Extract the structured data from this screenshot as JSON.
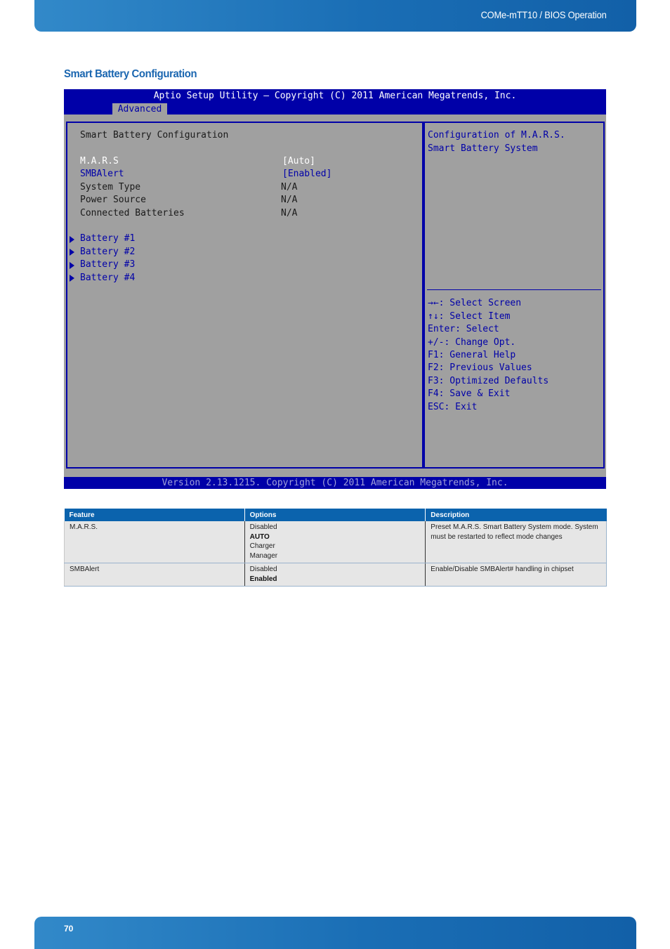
{
  "header": {
    "doc_title": "COMe-mTT10 / BIOS Operation"
  },
  "section_title": "Smart Battery Configuration",
  "bios": {
    "title": "Aptio Setup Utility – Copyright (C) 2011 American Megatrends, Inc.",
    "active_tab": "Advanced",
    "page_heading": "Smart Battery Configuration",
    "settings": [
      {
        "label": "M.A.R.S",
        "value": "[Auto]",
        "state": "selected"
      },
      {
        "label": "SMBAlert",
        "value": "[Enabled]",
        "state": "selectable"
      },
      {
        "label": "System Type",
        "value": "N/A",
        "state": "readonly"
      },
      {
        "label": "Power Source",
        "value": "N/A",
        "state": "readonly"
      },
      {
        "label": "Connected Batteries",
        "value": "N/A",
        "state": "readonly"
      }
    ],
    "submenus": [
      "Battery #1",
      "Battery #2",
      "Battery #3",
      "Battery #4"
    ],
    "help_text": [
      "Configuration of M.A.R.S.",
      "Smart Battery System"
    ],
    "key_help": [
      "→←: Select Screen",
      "↑↓: Select Item",
      "Enter: Select",
      "+/-: Change Opt.",
      "F1: General Help",
      "F2: Previous Values",
      "F3: Optimized Defaults",
      "F4: Save & Exit",
      "ESC: Exit"
    ],
    "footer": "Version 2.13.1215. Copyright (C) 2011 American Megatrends, Inc.",
    "colors": {
      "bios_blue": "#0000a8",
      "bios_gray": "#a0a0a0"
    }
  },
  "table": {
    "headers": [
      "Feature",
      "Options",
      "Description"
    ],
    "rows": [
      {
        "feature": "M.A.R.S.",
        "options": [
          {
            "label": "Disabled",
            "default": false
          },
          {
            "label": "AUTO",
            "default": true
          },
          {
            "label": "Charger",
            "default": false
          },
          {
            "label": "Manager",
            "default": false
          }
        ],
        "description": "Preset M.A.R.S. Smart Battery System mode. System must be restarted to reflect mode changes"
      },
      {
        "feature": "SMBAlert",
        "options": [
          {
            "label": "Disabled",
            "default": false
          },
          {
            "label": "Enabled",
            "default": true
          }
        ],
        "description": "Enable/Disable SMBAlert# handling in chipset"
      }
    ]
  },
  "footer": {
    "page_number": "70"
  },
  "colors": {
    "brand_blue": "#1a6eb5",
    "heading_blue": "#1a66b0",
    "table_header": "#0b63ad"
  }
}
